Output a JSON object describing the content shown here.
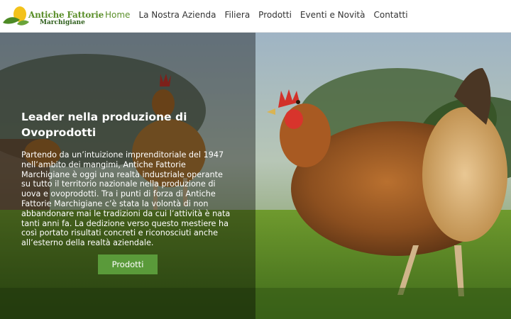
{
  "brand": {
    "name_line1": "Antiche Fattorie",
    "name_line2": "Marchigiane"
  },
  "nav": {
    "items": [
      {
        "label": "Home",
        "active": true
      },
      {
        "label": "La Nostra Azienda",
        "active": false
      },
      {
        "label": "Filiera",
        "active": false
      },
      {
        "label": "Prodotti",
        "active": false
      },
      {
        "label": "Eventi e Novità",
        "active": false
      },
      {
        "label": "Contatti",
        "active": false
      }
    ]
  },
  "hero": {
    "title": "Leader nella produzione di Ovoprodotti",
    "body": "Partendo da un’intuizione imprenditoriale del 1947 nell’ambito dei mangimi, Antiche Fattorie Marchigiane è oggi una realtà industriale operante su tutto il territorio nazionale nella produzione di uova e ovoprodotti. Tra i punti di forza di Antiche Fattorie Marchigiane c’è stata la volontà di non abbandonare mai le tradizioni da cui l’attività è nata tanti anni fa. La dedizione verso questo mestiere ha così portato risultati concreti e riconosciuti anche all’esterno della realtà aziendale.",
    "cta_label": "Prodotti"
  },
  "colors": {
    "accent": "#5b8f2a",
    "button": "#5a9a3a",
    "nav_text": "#333333"
  }
}
